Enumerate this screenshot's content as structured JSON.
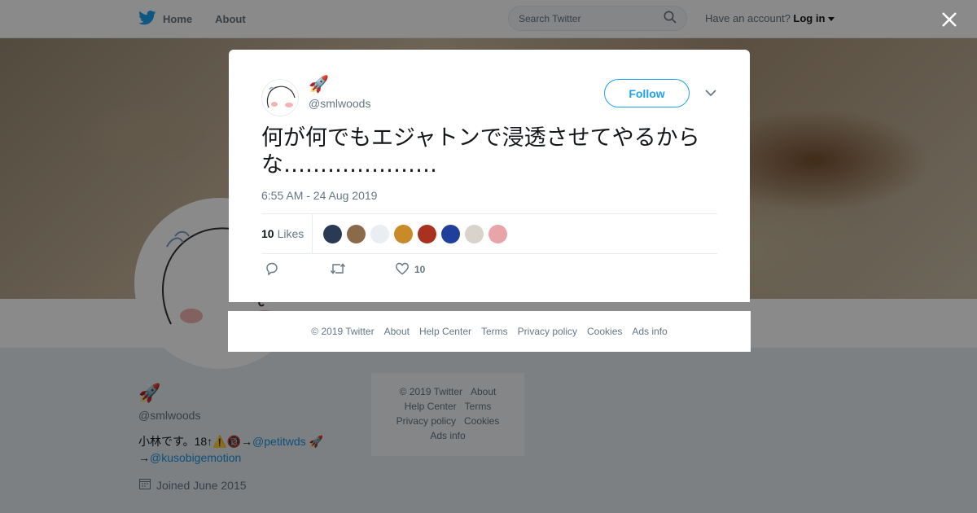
{
  "topbar": {
    "home_label": "Home",
    "about_label": "About",
    "search_placeholder": "Search Twitter",
    "have_account": "Have an account?",
    "login_label": "Log in"
  },
  "profile": {
    "display_name": "🚀",
    "handle": "@smlwoods",
    "bio_text": "小林です。18↑⚠️🔞→",
    "bio_link1": "@petitwds",
    "bio_rocket": "🚀",
    "bio_arrow": "→",
    "bio_link2": "@kusobigemotion",
    "joined": "Joined June 2015"
  },
  "side_footer": {
    "items": [
      "© 2019 Twitter",
      "About",
      "Help Center",
      "Terms",
      "Privacy policy",
      "Cookies",
      "Ads info"
    ]
  },
  "tweet": {
    "display_name": "🚀",
    "handle": "@smlwoods",
    "follow_label": "Follow",
    "text": "何が何でもエジャトンで浸透させてやるからな…………………",
    "timestamp": "6:55 AM - 24 Aug 2019",
    "likes_count": "10",
    "likes_label": "Likes",
    "like_action_count": "10",
    "liker_colors": [
      "#2a3a55",
      "#8a6a4a",
      "#e8eef2",
      "#c98a2a",
      "#a8321e",
      "#1f3f9a",
      "#d8d4cc",
      "#e8a4a8"
    ]
  },
  "modal_footer": {
    "items": [
      "© 2019 Twitter",
      "About",
      "Help Center",
      "Terms",
      "Privacy policy",
      "Cookies",
      "Ads info"
    ]
  },
  "colors": {
    "accent": "#1da1f2",
    "link": "#1b95e0",
    "muted": "#657786"
  }
}
